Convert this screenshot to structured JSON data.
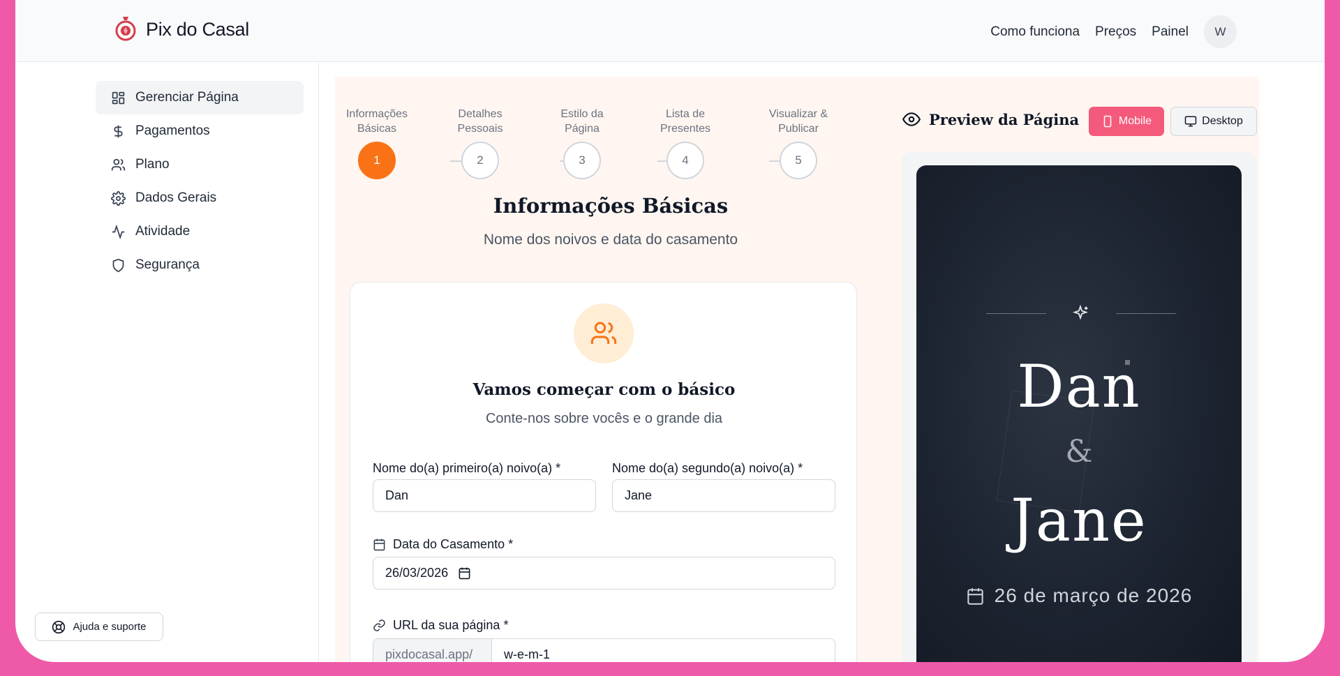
{
  "header": {
    "brand": "Pix do Casal",
    "nav": [
      "Como funciona",
      "Preços",
      "Painel"
    ],
    "avatar_initial": "W"
  },
  "sidebar": {
    "items": [
      {
        "label": "Gerenciar Página",
        "icon": "layout-grid-icon",
        "active": true
      },
      {
        "label": "Pagamentos",
        "icon": "dollar-icon"
      },
      {
        "label": "Plano",
        "icon": "users-icon"
      },
      {
        "label": "Dados Gerais",
        "icon": "gear-icon"
      },
      {
        "label": "Atividade",
        "icon": "activity-icon"
      },
      {
        "label": "Segurança",
        "icon": "shield-icon"
      }
    ],
    "help_label": "Ajuda e suporte"
  },
  "stepper": {
    "steps": [
      {
        "label1": "Informações",
        "label2": "Básicas",
        "number": "1"
      },
      {
        "label1": "Detalhes",
        "label2": "Pessoais",
        "number": "2"
      },
      {
        "label1": "Estilo da",
        "label2": "Página",
        "number": "3"
      },
      {
        "label1": "Lista de",
        "label2": "Presentes",
        "number": "4"
      },
      {
        "label1": "Visualizar &",
        "label2": "Publicar",
        "number": "5"
      }
    ],
    "current": 1
  },
  "section": {
    "title": "Informações Básicas",
    "subtitle": "Nome dos noivos e data do casamento"
  },
  "card": {
    "title": "Vamos começar com o básico",
    "subtitle": "Conte-nos sobre vocês e o grande dia",
    "first_name_label": "Nome do(a) primeiro(a) noivo(a) *",
    "first_name_value": "Dan",
    "second_name_label": "Nome do(a) segundo(a) noivo(a) *",
    "second_name_value": "Jane",
    "date_label": "Data do Casamento *",
    "date_value": "26/03/2026",
    "url_label": "URL da sua página *",
    "url_prefix": "pixdocasal.app/",
    "url_value": "w-e-m-1"
  },
  "preview": {
    "title": "Preview da Página",
    "mobile_label": "Mobile",
    "desktop_label": "Desktop",
    "name1": "Dan",
    "amp": "&",
    "name2": "Jane",
    "date": "26 de março de 2026"
  },
  "colors": {
    "accent_orange": "#f97316",
    "accent_pink": "#f45a7b",
    "frame_pink": "#ef5aa8"
  }
}
